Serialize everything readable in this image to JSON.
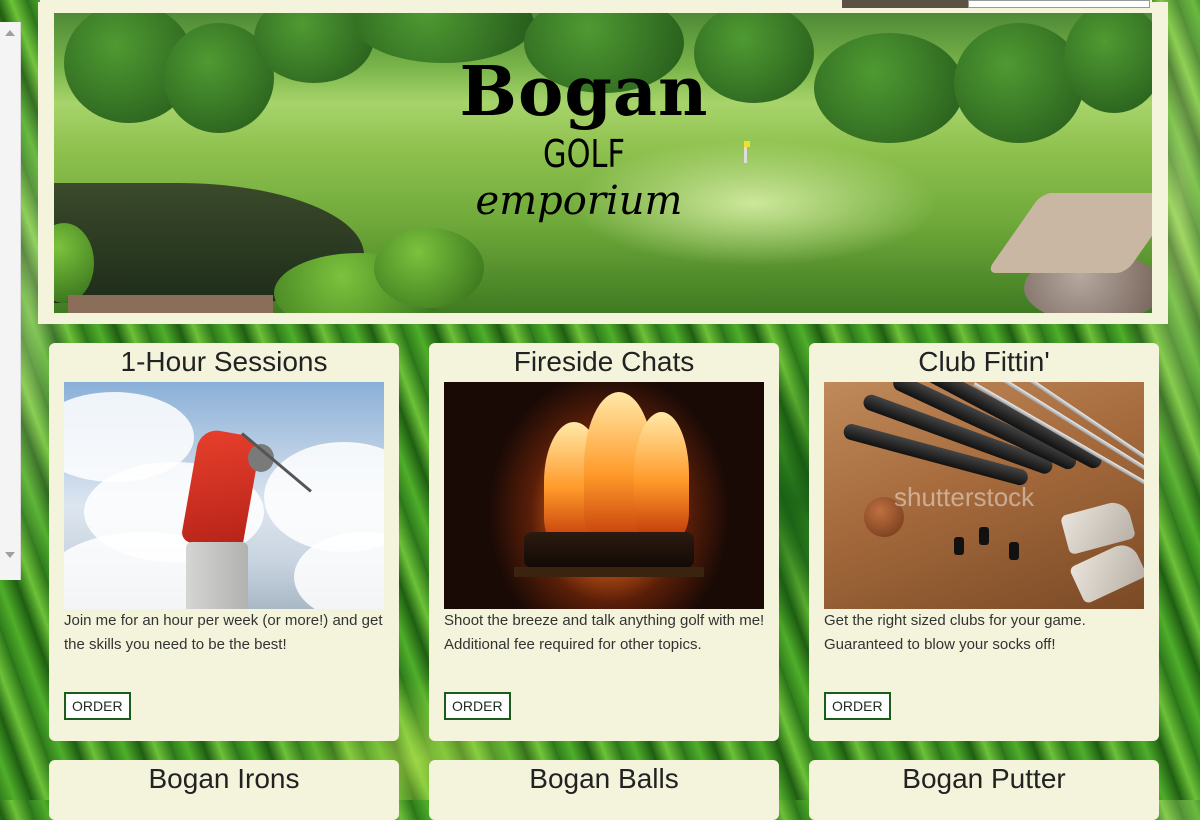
{
  "header": {
    "logo_line1": "Bogan",
    "logo_line2": "GOLF",
    "logo_line3": "emporium"
  },
  "cards": [
    {
      "title": "1-Hour Sessions",
      "description": "Join me for an hour per week (or more!) and get the skills you need to be the best!",
      "button": "ORDER"
    },
    {
      "title": "Fireside Chats",
      "description": "Shoot the breeze and talk anything golf with me! Additional fee required for other topics.",
      "button": "ORDER"
    },
    {
      "title": "Club Fittin'",
      "description": "Get the right sized clubs for your game. Guaranteed to blow your socks off!",
      "button": "ORDER",
      "watermark": "shutterstock"
    }
  ],
  "cards_row2": [
    {
      "title": "Bogan Irons"
    },
    {
      "title": "Bogan Balls"
    },
    {
      "title": "Bogan Putter"
    }
  ],
  "colors": {
    "card_bg": "#f4f4dc",
    "button_border": "#1a5c1a",
    "accent": "#3a8c22"
  }
}
